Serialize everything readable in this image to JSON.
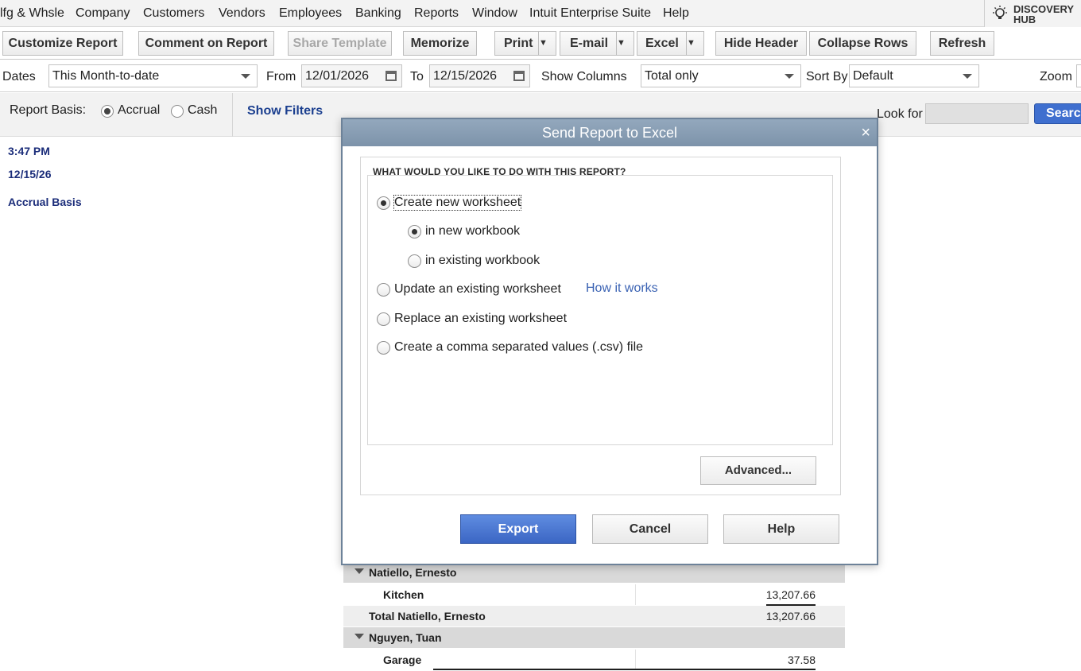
{
  "menubar": {
    "items": [
      "lfg & Whsle",
      "Company",
      "Customers",
      "Vendors",
      "Employees",
      "Banking",
      "Reports",
      "Window",
      "Intuit Enterprise Suite",
      "Help"
    ],
    "discovery_line1": "DISCOVERY",
    "discovery_line2": "HUB"
  },
  "toolbar": {
    "customize": "Customize Report",
    "comment": "Comment on Report",
    "share": "Share Template",
    "memorize": "Memorize",
    "print": "Print",
    "email": "E-mail",
    "excel": "Excel",
    "hide_header": "Hide Header",
    "collapse_rows": "Collapse Rows",
    "refresh": "Refresh",
    "dropdown_glyph": "▼"
  },
  "datesbar": {
    "dates_label": "Dates",
    "dates_value": "This Month-to-date",
    "from_label": "From",
    "from_value": "12/01/2026",
    "to_label": "To",
    "to_value": "12/15/2026",
    "show_columns_label": "Show Columns",
    "show_columns_value": "Total only",
    "sort_by_label": "Sort By",
    "sort_by_value": "Default",
    "zoom_label": "Zoom"
  },
  "basisbar": {
    "label": "Report Basis:",
    "accrual": "Accrual",
    "cash": "Cash",
    "selected": "Accrual",
    "show_filters": "Show Filters",
    "look_for": "Look for",
    "search": "Search"
  },
  "report_header": {
    "time": "3:47 PM",
    "date": "12/15/26",
    "basis": "Accrual Basis"
  },
  "report_rows": [
    {
      "type": "group",
      "name": "Natiello, Ernesto",
      "amount": ""
    },
    {
      "type": "item",
      "name": "Kitchen",
      "amount": "13,207.66"
    },
    {
      "type": "total",
      "name": "Total Natiello, Ernesto",
      "amount": "13,207.66"
    },
    {
      "type": "group",
      "name": "Nguyen, Tuan",
      "amount": ""
    },
    {
      "type": "item",
      "name": "Garage",
      "amount": "37.58"
    }
  ],
  "dialog": {
    "title": "Send Report to Excel",
    "close": "×",
    "group_label": "WHAT WOULD YOU LIKE TO DO WITH THIS REPORT?",
    "opt_new_worksheet": "Create new worksheet",
    "opt_new_workbook": "in new workbook",
    "opt_existing_workbook": "in existing workbook",
    "opt_update": "Update an existing worksheet",
    "how_it_works": "How it works",
    "opt_replace": "Replace an existing worksheet",
    "opt_csv": "Create a comma separated values (.csv) file",
    "selected_option": "Create new worksheet",
    "selected_sub_option": "in new workbook",
    "advanced": "Advanced...",
    "export": "Export",
    "cancel": "Cancel",
    "help": "Help"
  },
  "colors": {
    "accent_blue": "#3b66c4",
    "title_bar": "#7d93aa",
    "report_text": "#1b2d7a",
    "link": "#3a62b3"
  }
}
